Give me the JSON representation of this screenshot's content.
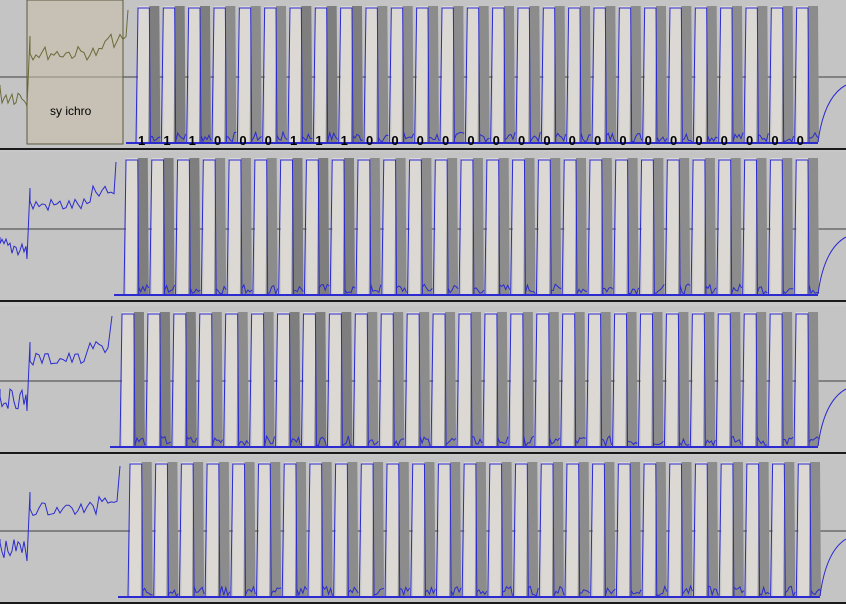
{
  "annotation": {
    "sync_label": "sy ichro"
  },
  "bits": [
    "1",
    "1",
    "1",
    "0",
    "0",
    "0",
    "1",
    "1",
    "1",
    "0",
    "0",
    "0",
    "0",
    "0",
    "0",
    "0",
    "0",
    "0",
    "0",
    "0",
    "0",
    "0",
    "0",
    "0",
    "0",
    "0",
    "0"
  ],
  "colors": {
    "waveform": "#2b2bd0",
    "sync_wave": "#6b6a38",
    "sync_fill": "#c9c0a8",
    "dark_cell": "#8c8c8c",
    "light_cell": "#dcd8d4",
    "track_bg": "#c4c4c4",
    "center_line": "#404040",
    "divider": "#1a1a1a"
  },
  "tracks": [
    {
      "id": "track-1",
      "cells": [
        "D",
        "D",
        "D",
        "L",
        "L",
        "L",
        "D",
        "D",
        "D",
        "L",
        "L",
        "L",
        "L",
        "L",
        "L",
        "L",
        "L",
        "L",
        "L",
        "L",
        "L",
        "L",
        "L",
        "L",
        "L",
        "L",
        "L"
      ]
    },
    {
      "id": "track-2",
      "cells": [
        "D",
        "D",
        "D",
        "L",
        "L",
        "L",
        "D",
        "D",
        "D",
        "L",
        "L",
        "L",
        "L",
        "L",
        "L",
        "L",
        "L",
        "L",
        "L",
        "L",
        "L",
        "L",
        "L",
        "L",
        "L",
        "L",
        "L"
      ]
    },
    {
      "id": "track-3",
      "cells": [
        "D",
        "D",
        "D",
        "L",
        "L",
        "L",
        "D",
        "D",
        "D",
        "L",
        "L",
        "L",
        "L",
        "L",
        "L",
        "L",
        "L",
        "L",
        "L",
        "L",
        "L",
        "L",
        "L",
        "L",
        "L",
        "L",
        "L"
      ]
    },
    {
      "id": "track-4",
      "cells": [
        "L",
        "L",
        "L",
        "L",
        "L",
        "L",
        "L",
        "L",
        "L",
        "L",
        "L",
        "L",
        "L",
        "L",
        "L",
        "L",
        "L",
        "L",
        "L",
        "L",
        "L",
        "L",
        "L",
        "L",
        "L",
        "L",
        "L"
      ]
    }
  ]
}
